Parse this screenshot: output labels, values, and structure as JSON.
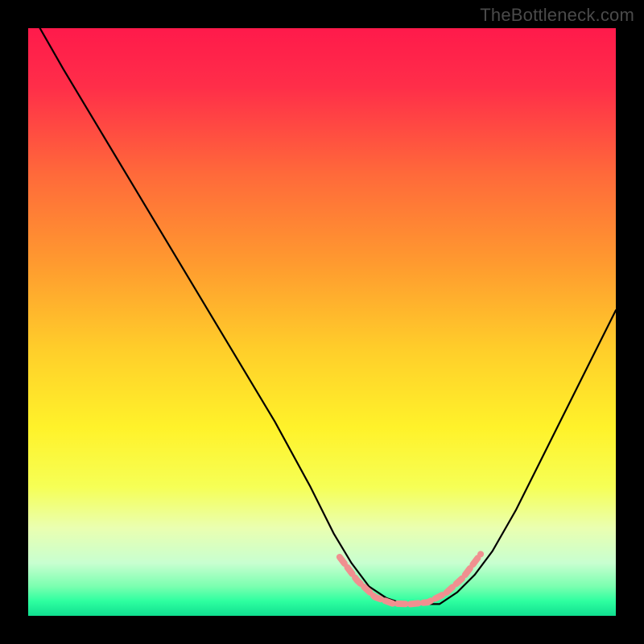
{
  "watermark": "TheBottleneck.com",
  "chart_data": {
    "type": "line",
    "title": "",
    "xlabel": "",
    "ylabel": "",
    "xlim": [
      0,
      100
    ],
    "ylim": [
      0,
      100
    ],
    "gradient_stops": [
      {
        "offset": 0,
        "color": "#ff1a4b"
      },
      {
        "offset": 0.1,
        "color": "#ff2e49"
      },
      {
        "offset": 0.25,
        "color": "#ff6a3a"
      },
      {
        "offset": 0.4,
        "color": "#ff9a2f"
      },
      {
        "offset": 0.55,
        "color": "#ffcf2a"
      },
      {
        "offset": 0.68,
        "color": "#fff22a"
      },
      {
        "offset": 0.78,
        "color": "#f6ff55"
      },
      {
        "offset": 0.85,
        "color": "#eaffb0"
      },
      {
        "offset": 0.91,
        "color": "#c8ffd0"
      },
      {
        "offset": 0.95,
        "color": "#7affb0"
      },
      {
        "offset": 0.975,
        "color": "#2effa0"
      },
      {
        "offset": 1.0,
        "color": "#10df90"
      }
    ],
    "series": [
      {
        "name": "main-curve",
        "color": "#000000",
        "width": 2.2,
        "x": [
          2,
          6,
          12,
          18,
          24,
          30,
          36,
          42,
          48,
          52,
          55,
          58,
          61,
          64,
          67,
          70,
          73,
          76,
          79,
          83,
          87,
          91,
          95,
          100
        ],
        "y": [
          100,
          93,
          83,
          73,
          63,
          53,
          43,
          33,
          22,
          14,
          9,
          5,
          3,
          2,
          2,
          2,
          4,
          7,
          11,
          18,
          26,
          34,
          42,
          52
        ]
      },
      {
        "name": "highlight-segment",
        "color": "#f09090",
        "width": 8,
        "dash": "10 6",
        "x": [
          53,
          56,
          59,
          62,
          65,
          68,
          71,
          74,
          77
        ],
        "y": [
          10,
          6,
          3.2,
          2.1,
          2.0,
          2.3,
          3.8,
          6.5,
          10.5
        ]
      }
    ]
  }
}
